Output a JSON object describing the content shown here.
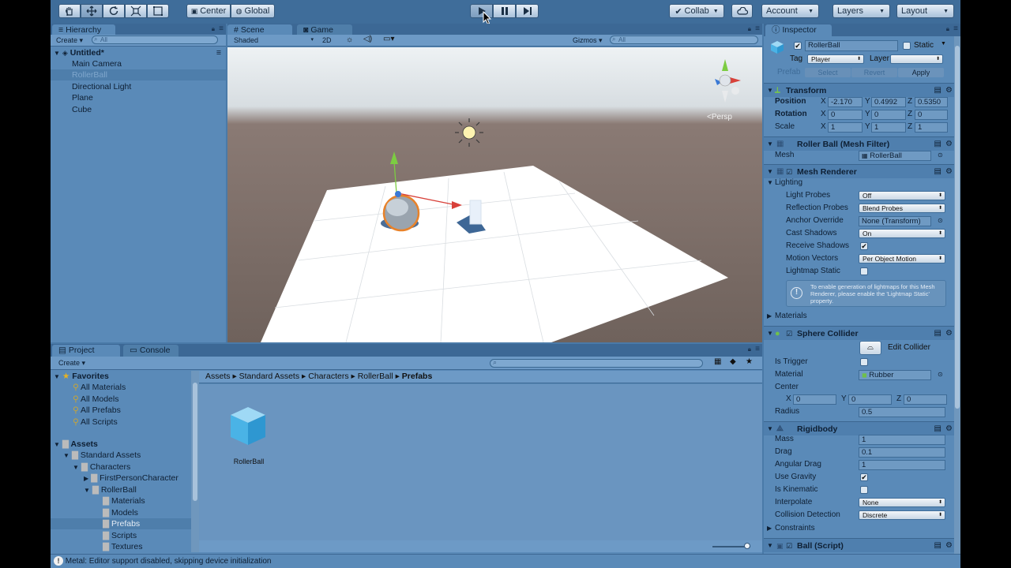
{
  "toolbar": {
    "pivot_label": "Center",
    "space_label": "Global",
    "collab_label": "Collab",
    "account_label": "Account",
    "layers_label": "Layers",
    "layout_label": "Layout",
    "tools": [
      "hand-icon",
      "move-icon",
      "rotate-icon",
      "scale-icon",
      "rect-icon"
    ]
  },
  "hierarchy": {
    "tab": "Hierarchy",
    "create_label": "Create",
    "search_placeholder": "All",
    "scene_name": "Untitled*",
    "items": [
      "Main Camera",
      "RollerBall",
      "Directional Light",
      "Plane",
      "Cube"
    ],
    "selected": "RollerBall"
  },
  "scene_view": {
    "tabs": [
      "Scene",
      "Game"
    ],
    "shading": "Shaded",
    "mode_2d": "2D",
    "gizmos_label": "Gizmos",
    "search_placeholder": "All",
    "persp_label": "Persp"
  },
  "project": {
    "tabs": [
      "Project",
      "Console"
    ],
    "create_label": "Create",
    "favorites_label": "Favorites",
    "favorites": [
      "All Materials",
      "All Models",
      "All Prefabs",
      "All Scripts"
    ],
    "assets_label": "Assets",
    "tree": [
      {
        "label": "Standard Assets",
        "indent": 1
      },
      {
        "label": "Characters",
        "indent": 2
      },
      {
        "label": "FirstPersonCharacter",
        "indent": 3
      },
      {
        "label": "RollerBall",
        "indent": 3
      },
      {
        "label": "Materials",
        "indent": 4
      },
      {
        "label": "Models",
        "indent": 4
      },
      {
        "label": "Prefabs",
        "indent": 4
      },
      {
        "label": "Scripts",
        "indent": 4
      },
      {
        "label": "Textures",
        "indent": 4
      }
    ],
    "breadcrumb": [
      "Assets",
      "Standard Assets",
      "Characters",
      "RollerBall",
      "Prefabs"
    ],
    "asset_name": "RollerBall"
  },
  "inspector": {
    "tab": "Inspector",
    "object_name": "RollerBall",
    "static_label": "Static",
    "tag_label": "Tag",
    "tag_value": "Player",
    "layer_label": "Layer",
    "layer_value": "",
    "prefab_label": "Prefab",
    "select_label": "Select",
    "revert_label": "Revert",
    "apply_label": "Apply",
    "transform": {
      "title": "Transform",
      "position_label": "Position",
      "rotation_label": "Rotation",
      "scale_label": "Scale",
      "position": [
        "-2.170",
        "0.4992",
        "0.5350"
      ],
      "rotation": [
        "0",
        "0",
        "0"
      ],
      "scale": [
        "1",
        "1",
        "1"
      ]
    },
    "mesh_filter": {
      "title": "Roller Ball (Mesh Filter)",
      "mesh_label": "Mesh",
      "mesh_value": "RollerBall"
    },
    "mesh_renderer": {
      "title": "Mesh Renderer",
      "lighting_label": "Lighting",
      "light_probes_label": "Light Probes",
      "light_probes": "Off",
      "reflection_probes_label": "Reflection Probes",
      "reflection_probes": "Blend Probes",
      "anchor_override_label": "Anchor Override",
      "anchor_override": "None (Transform)",
      "cast_shadows_label": "Cast Shadows",
      "cast_shadows": "On",
      "receive_shadows_label": "Receive Shadows",
      "motion_vectors_label": "Motion Vectors",
      "motion_vectors": "Per Object Motion",
      "lightmap_static_label": "Lightmap Static",
      "info_text": "To enable generation of lightmaps for this Mesh Renderer, please enable the 'Lightmap Static' property.",
      "materials_label": "Materials"
    },
    "sphere_collider": {
      "title": "Sphere Collider",
      "edit_label": "Edit Collider",
      "is_trigger_label": "Is Trigger",
      "material_label": "Material",
      "material_value": "Rubber",
      "center_label": "Center",
      "center": [
        "0",
        "0",
        "0"
      ],
      "radius_label": "Radius",
      "radius": "0.5"
    },
    "rigidbody": {
      "title": "Rigidbody",
      "mass_label": "Mass",
      "mass": "1",
      "drag_label": "Drag",
      "drag": "0.1",
      "angular_drag_label": "Angular Drag",
      "angular_drag": "1",
      "use_gravity_label": "Use Gravity",
      "is_kinematic_label": "Is Kinematic",
      "interpolate_label": "Interpolate",
      "interpolate": "None",
      "collision_label": "Collision Detection",
      "collision": "Discrete",
      "constraints_label": "Constraints"
    },
    "script": {
      "title": "Ball (Script)"
    }
  },
  "status": {
    "message": "Metal: Editor support disabled, skipping device initialization"
  },
  "axis": {
    "x": "X",
    "y": "Y",
    "z": "Z",
    "check": "✔"
  }
}
